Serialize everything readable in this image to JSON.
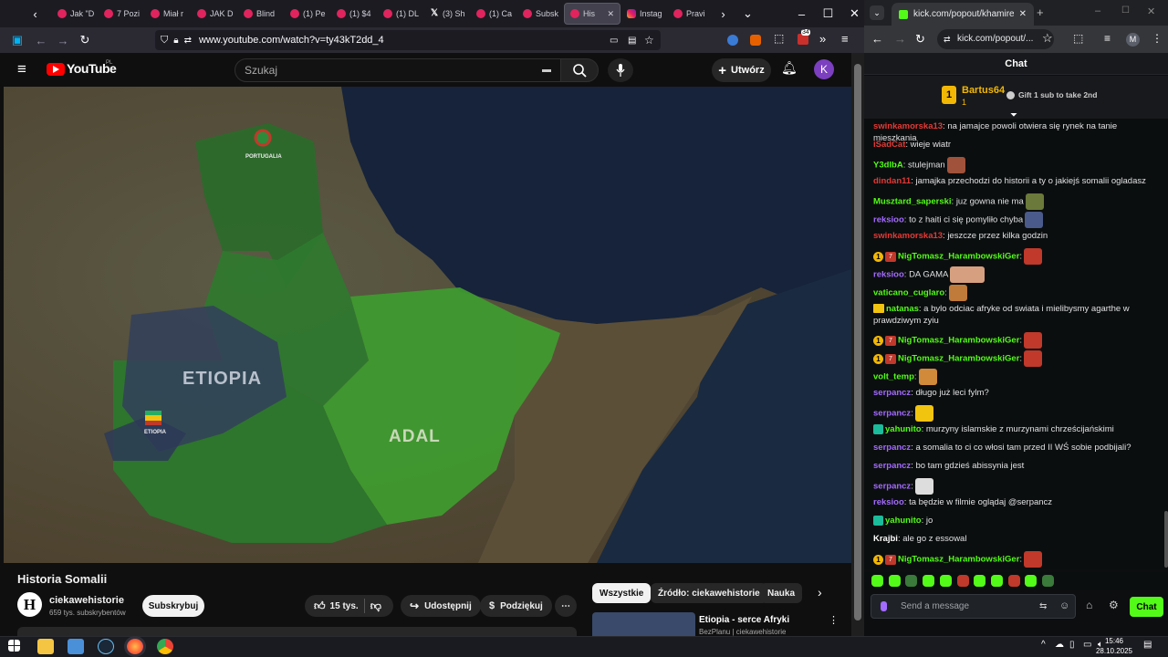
{
  "firefox": {
    "tabs": [
      {
        "label": "Jak \"D",
        "icon": "youtube-icon"
      },
      {
        "label": "7 Pozi",
        "icon": "youtube-icon"
      },
      {
        "label": "Miał r",
        "icon": "youtube-icon"
      },
      {
        "label": "JAK D",
        "icon": "youtube-icon"
      },
      {
        "label": "Blind",
        "icon": "youtube-icon"
      },
      {
        "label": "(1) Pe",
        "icon": "youtube-icon"
      },
      {
        "label": "(1) $4",
        "icon": "youtube-icon"
      },
      {
        "label": "(1) DL",
        "icon": "youtube-icon"
      },
      {
        "label": "(3) Sh",
        "icon": "x-icon"
      },
      {
        "label": "(1) Ca",
        "icon": "youtube-icon"
      },
      {
        "label": "Subsk",
        "icon": "youtube-icon"
      },
      {
        "label": "His",
        "icon": "youtube-icon",
        "active": true
      },
      {
        "label": "Instag",
        "icon": "instagram-icon"
      },
      {
        "label": "Pravi",
        "icon": "youtube-icon"
      }
    ],
    "url": "www.youtube.com/watch?v=ty43kT2dd_4",
    "notification_count": "34"
  },
  "youtube": {
    "logo_text": "YouTube",
    "region": "PL",
    "search_placeholder": "Szukaj",
    "create_label": "Utwórz",
    "avatar_letter": "K",
    "map_labels": {
      "portugalia": "PORTUGALIA",
      "etiopia_big": "ETIOPIA",
      "etiopia_small": "ETIOPIA",
      "adal": "ADAL"
    },
    "video_title": "Historia Somalii",
    "channel_name": "ciekawehistorie",
    "channel_avatar_letter": "H",
    "subscribers": "659 tys. subskrybentów",
    "subscribe_label": "Subskrybuj",
    "likes": "15 tys.",
    "share_label": "Udostępnij",
    "thanks_label": "Podziękuj",
    "chips": [
      "Wszystkie",
      "Źródło: ciekawehistorie",
      "Nauka"
    ],
    "related": {
      "title": "Etiopia - serce Afryki",
      "channel": "BezPlanu | ciekawehistorie"
    }
  },
  "chrome": {
    "tab_title": "kick.com/popout/khamires/cha",
    "url": "kick.com/popout/...",
    "profile_letter": "M"
  },
  "chat": {
    "header": "Chat",
    "pinned": {
      "user": "Bartus64",
      "count": "1",
      "gift_text": "Gift 1 sub to take 2nd"
    },
    "messages": [
      {
        "user": "swinkamorska13",
        "text": ": na jamajce powoli otwiera się rynek na tanie mieszkania",
        "color": "#e53935"
      },
      {
        "user": "iSadCat",
        "text": ": wieje wiatr",
        "color": "#e53935"
      },
      {
        "user": "Y3dlbA",
        "text": ": stulejman",
        "color": "#53fc18"
      },
      {
        "user": "dindan11",
        "text": ": jamajka przechodzi do historii a ty o jakiejś somalii ogladasz",
        "color": "#e53935"
      },
      {
        "user": "Musztard_saperski",
        "text": ": juz gowna nie ma",
        "color": "#53fc18"
      },
      {
        "user": "reksioo",
        "text": ": to z haiti ci się pomyliło chyba",
        "color": "#a36bff"
      },
      {
        "user": "swinkamorska13",
        "text": ": jeszcze przez kilka godzin",
        "color": "#e53935"
      },
      {
        "user": "NigTomasz_HarambowskiGer",
        "text": ":",
        "color": "#53fc18"
      },
      {
        "user": "reksioo",
        "text": ": DA GAMA",
        "color": "#a36bff"
      },
      {
        "user": "vaticano_cuglaro",
        "text": ":",
        "color": "#53fc18"
      },
      {
        "user": "natanas",
        "text": ": a bylo odciac afryke od swiata i mielibysmy agarthe w prawdziwym zyiu",
        "color": "#53fc18"
      },
      {
        "user": "NigTomasz_HarambowskiGer",
        "text": ":",
        "color": "#53fc18"
      },
      {
        "user": "NigTomasz_HarambowskiGer",
        "text": ":",
        "color": "#53fc18"
      },
      {
        "user": "volt_temp",
        "text": ":",
        "color": "#53fc18"
      },
      {
        "user": "serpancz",
        "text": ": długo już leci fylm?",
        "color": "#a36bff"
      },
      {
        "user": "serpancz",
        "text": ":",
        "color": "#a36bff"
      },
      {
        "user": "yahunito",
        "text": ": murzyny islamskie z murzynami chrześcijańskimi",
        "color": "#53fc18"
      },
      {
        "user": "serpancz",
        "text": ": a somalia to ci co włosi tam przed II WŚ sobie podbijali?",
        "color": "#a36bff"
      },
      {
        "user": "serpancz",
        "text": ": bo tam gdzieś abissynia jest",
        "color": "#a36bff"
      },
      {
        "user": "serpancz",
        "text": ":",
        "color": "#a36bff"
      },
      {
        "user": "reksioo",
        "text": ": ta będzie w filmie oglądaj @serpancz",
        "color": "#a36bff"
      },
      {
        "user": "yahunito",
        "text": ": jo",
        "color": "#53fc18"
      },
      {
        "user": "Krajbi",
        "text": ": ale go z essowal",
        "color": "#ffffff"
      },
      {
        "user": "NigTomasz_HarambowskiGer",
        "text": ":",
        "color": "#53fc18"
      }
    ],
    "input_placeholder": "Send a message",
    "send_label": "Chat"
  },
  "taskbar": {
    "time": "15:46",
    "date": "28.10.2025"
  }
}
